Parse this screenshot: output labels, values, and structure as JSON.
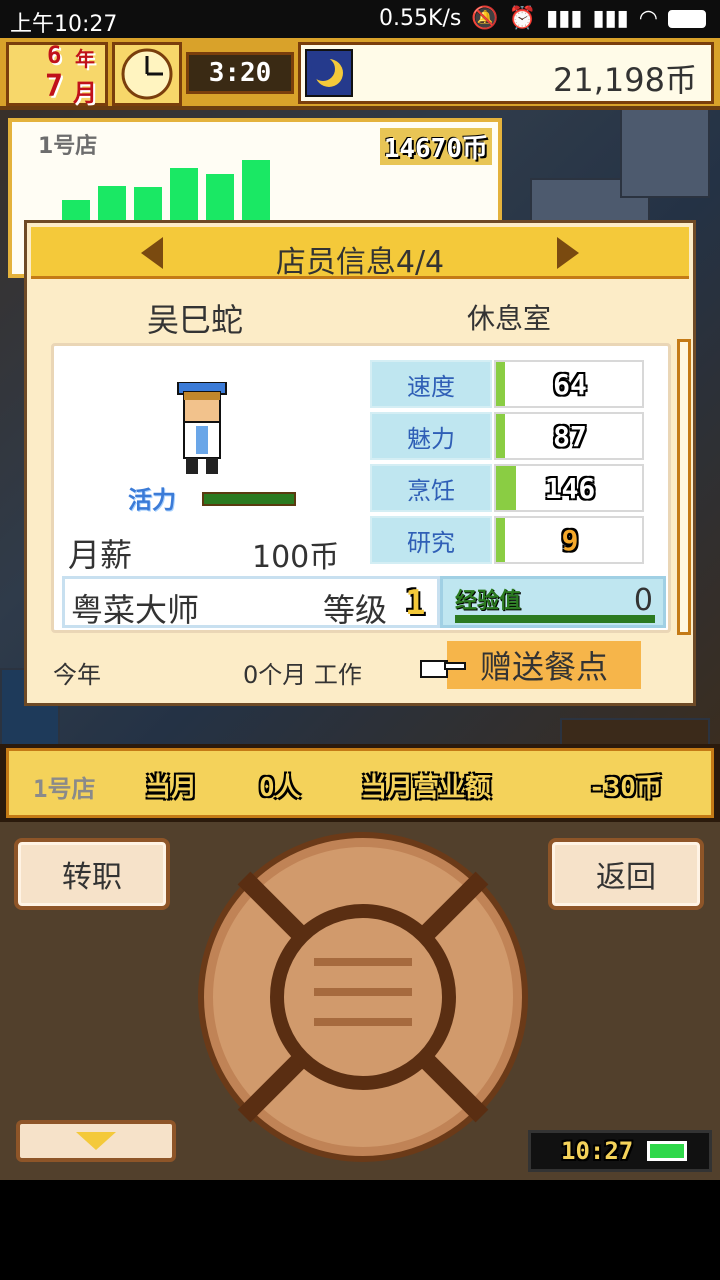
{
  "status_bar": {
    "time": "上午10:27",
    "net_speed": "0.55K/s"
  },
  "hud": {
    "month_top": "6",
    "year_char": "年",
    "month": "7",
    "month_char": "月",
    "time": "3:20",
    "money": "21,198币"
  },
  "store_panel": {
    "name": "1号店",
    "sales": "14670币",
    "bars": [
      0.3,
      0.48,
      0.46,
      0.7,
      0.62,
      0.8
    ]
  },
  "dialog": {
    "title": "店员信息4/4",
    "staff_name": "吴巳蛇",
    "location": "休息室",
    "vitality_label": "活力",
    "salary_label": "月薪",
    "salary_value": "100币",
    "stats": [
      {
        "name": "速度",
        "value": "64",
        "fill": 0.06
      },
      {
        "name": "魅力",
        "value": "87",
        "fill": 0.06
      },
      {
        "name": "烹饪",
        "value": "146",
        "fill": 0.14
      },
      {
        "name": "研究",
        "value": "9",
        "fill": 0.06
      }
    ],
    "job_title": "粤菜大师",
    "level_label": "等级",
    "level_value": "1",
    "exp_label": "经验值",
    "exp_value": "0",
    "year_label": "今年",
    "work_text": "0个月 工作",
    "gift_label": "赠送餐点"
  },
  "info_bar": {
    "store": "1号店",
    "this_month": "当月",
    "customers": "0人",
    "revenue_label": "当月营业额",
    "revenue": "-30币"
  },
  "controls": {
    "left_btn": "转职",
    "right_btn": "返回"
  },
  "bottom_clock": {
    "time": "10:27"
  },
  "colors": {
    "gold": "#f4c93a",
    "brown": "#6e4a26",
    "bar_green": "#1ae864",
    "stat_green": "#8acd43"
  }
}
